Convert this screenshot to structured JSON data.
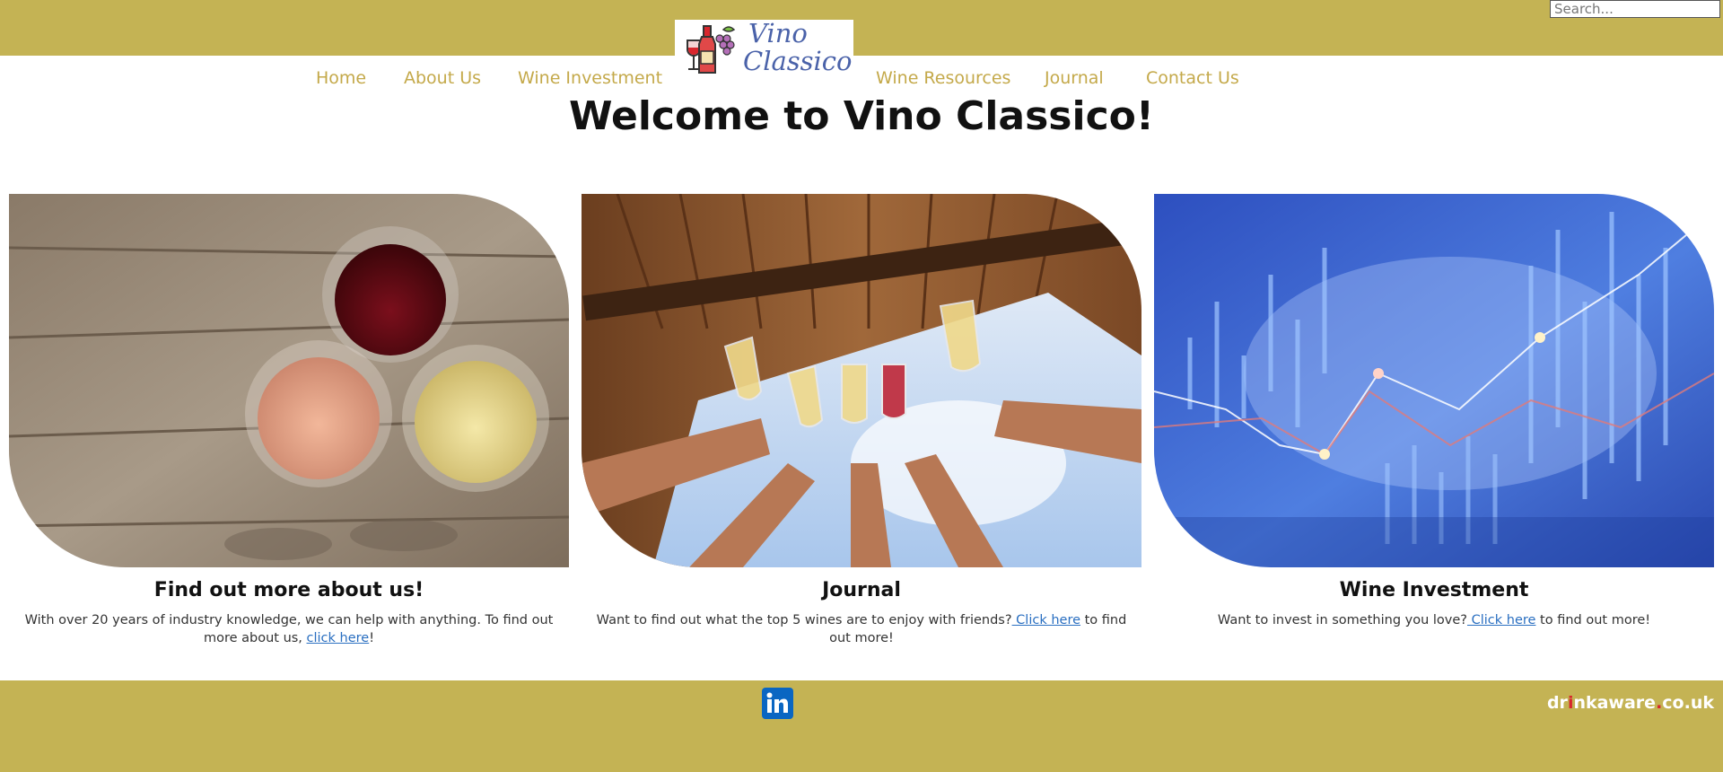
{
  "header": {
    "search_placeholder": "Search...",
    "logo": {
      "line1": "Vino",
      "line2": "Classico"
    },
    "nav": [
      {
        "label": "Home"
      },
      {
        "label": "About Us"
      },
      {
        "label": "Wine Investment"
      },
      {
        "label": "Wine Resources"
      },
      {
        "label": "Journal"
      },
      {
        "label": "Contact Us"
      }
    ]
  },
  "main": {
    "title": "Welcome to Vino Classico!",
    "cards": [
      {
        "title": "Find out more about us!",
        "text_before": "With over 20 years of industry knowledge, we can help with anything. To find out more about us, ",
        "link": "click here",
        "text_after": "!"
      },
      {
        "title": "Journal",
        "text_before": "Want to find out what the top 5 wines are to enjoy with friends?",
        "link": " Click here",
        "text_after": " to find out more!"
      },
      {
        "title": "Wine Investment",
        "text_before": "Want to invest in something you love?",
        "link": " Click here",
        "text_after": " to find out more!"
      }
    ]
  },
  "footer": {
    "social_icon": "linkedin-icon",
    "drinkaware": {
      "pre": "dr",
      "dot": "i",
      "mid": "nkaware",
      "dot2": ".",
      "post": "co.uk"
    }
  },
  "colors": {
    "brand_gold": "#c4b354",
    "nav_text": "#c4a94a",
    "logo_blue": "#4a62a9",
    "link_blue": "#2a6fc1",
    "linkedin_blue": "#0a66c2"
  }
}
